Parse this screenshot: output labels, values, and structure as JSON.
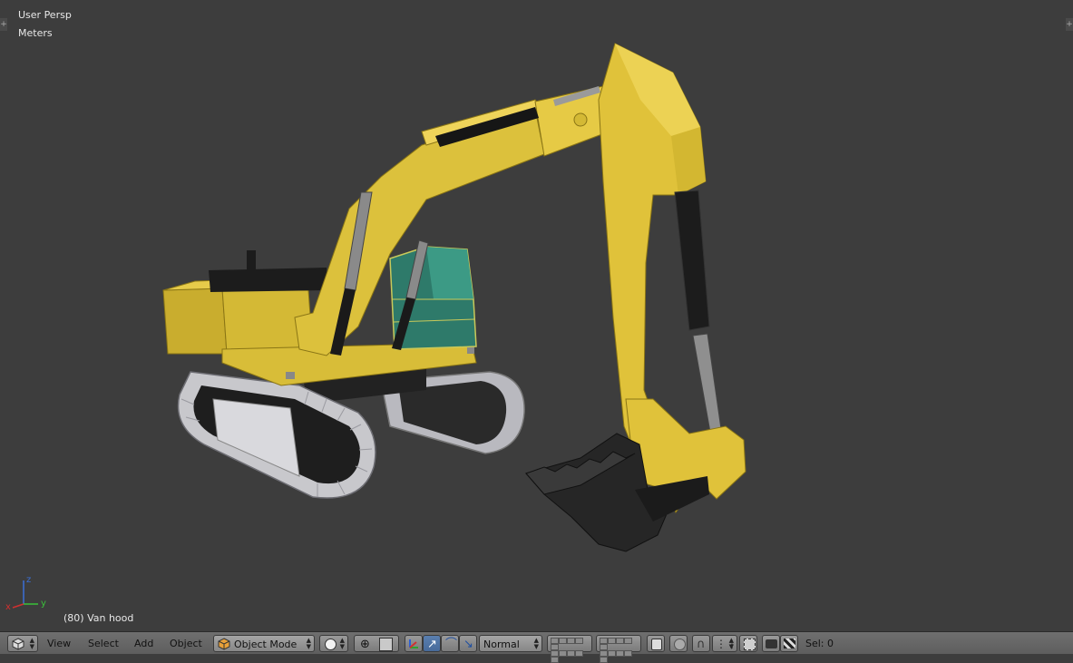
{
  "viewport": {
    "view_name": "User Persp",
    "units": "Meters",
    "object_info": "(80) Van hood",
    "axis_labels": {
      "x": "x",
      "y": "y",
      "z": "z"
    }
  },
  "header": {
    "menus": [
      "View",
      "Select",
      "Add",
      "Object"
    ],
    "mode": "Object Mode",
    "orientation": "Normal",
    "status": "Sel: 0"
  },
  "colors": {
    "viewport_bg": "#3d3d3d",
    "excavator_yellow": "#e0c23a",
    "cab_glass": "#2e7a6a",
    "track_gray": "#c8c8cc",
    "header_bg": "#6a6a6a",
    "active_blue": "#5a7fb0"
  },
  "icons": {
    "editor_type": "3d-view-cube-icon",
    "mode": "object-mode-cube-icon",
    "shading": "solid-sphere-icon",
    "pivot": "pivot-point-icon",
    "manipulator": "manipulator-axes-icon",
    "translate": "translate-arrow-icon",
    "rotate": "rotate-arc-icon",
    "scale": "scale-icon",
    "proportional": "proportional-edit-icon",
    "snap": "magnet-snap-icon",
    "render": "render-camera-icon",
    "anim_render": "clapper-icon"
  }
}
